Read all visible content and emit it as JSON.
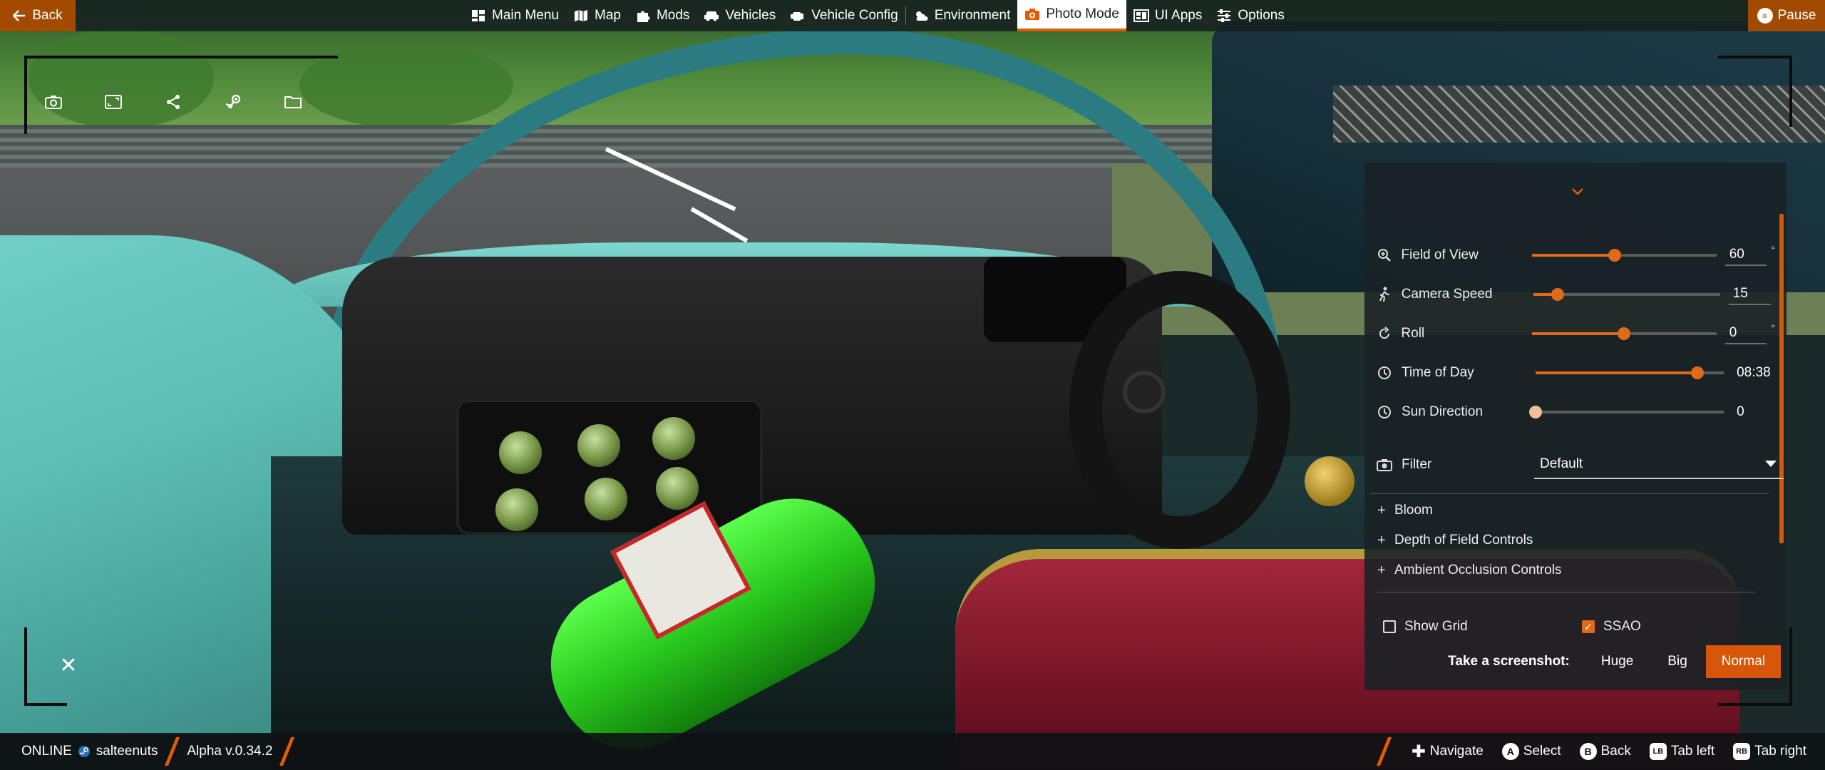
{
  "topbar": {
    "back_label": "Back",
    "pause_label": "Pause",
    "nav": [
      {
        "label": "Main Menu",
        "icon": "dashboard-icon"
      },
      {
        "label": "Map",
        "icon": "map-icon"
      },
      {
        "label": "Mods",
        "icon": "puzzle-icon"
      },
      {
        "label": "Vehicles",
        "icon": "car-icon"
      },
      {
        "label": "Vehicle Config",
        "icon": "engine-icon"
      },
      {
        "label": "Environment",
        "icon": "weather-icon"
      },
      {
        "label": "Photo Mode",
        "icon": "camera-icon",
        "active": true
      },
      {
        "label": "UI Apps",
        "icon": "apps-icon"
      },
      {
        "label": "Options",
        "icon": "sliders-icon"
      }
    ]
  },
  "photo_tools": [
    "camera-icon",
    "fullscreen-icon",
    "share-icon",
    "steam-icon",
    "folder-icon"
  ],
  "panel": {
    "sliders": [
      {
        "label": "Field of View",
        "icon": "zoom-icon",
        "value": "60",
        "unit": "°",
        "fraction": 0.45
      },
      {
        "label": "Camera Speed",
        "icon": "walking-icon",
        "value": "15",
        "unit": "",
        "fraction": 0.13
      },
      {
        "label": "Roll",
        "icon": "rotate-icon",
        "value": "0",
        "unit": "°",
        "fraction": 0.5
      },
      {
        "label": "Time of Day",
        "icon": "clock-icon",
        "value": "08:38",
        "unit": "",
        "fraction": 0.86
      },
      {
        "label": "Sun Direction",
        "icon": "clock-icon",
        "value": "0",
        "unit": "",
        "fraction": 0.0
      }
    ],
    "filter": {
      "label": "Filter",
      "icon": "camera-filter-icon",
      "value": "Default"
    },
    "sections": [
      "Bloom",
      "Depth of Field Controls",
      "Ambient Occlusion Controls"
    ],
    "show_grid": {
      "label": "Show Grid",
      "checked": false
    },
    "ssao": {
      "label": "SSAO",
      "checked": true
    },
    "screenshot": {
      "label": "Take a screenshot:",
      "options": [
        "Huge",
        "Big",
        "Normal"
      ],
      "selected": "Normal"
    }
  },
  "bottombar": {
    "status": "ONLINE",
    "user": "salteenuts",
    "version": "Alpha v.0.34.2",
    "hints": [
      {
        "glyph": "✚",
        "label": "Navigate"
      },
      {
        "glyph": "A",
        "label": "Select"
      },
      {
        "glyph": "B",
        "label": "Back"
      },
      {
        "glyph": "LB",
        "label": "Tab left"
      },
      {
        "glyph": "RB",
        "label": "Tab right"
      }
    ]
  },
  "colors": {
    "accent": "#e35d00",
    "button": "#a24b00"
  }
}
